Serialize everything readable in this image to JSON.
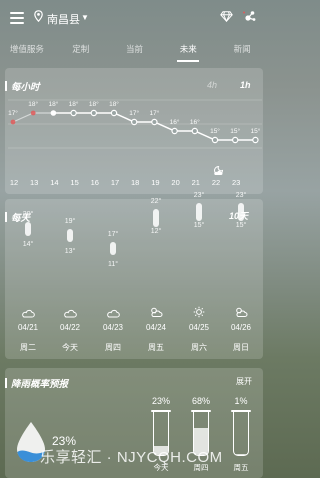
{
  "header": {
    "location": "南昌县",
    "colors": {
      "accent_red": "#e05a5a",
      "drop_blue": "#3a8fd8"
    }
  },
  "tabs": [
    {
      "label": "增值服务",
      "active": false
    },
    {
      "label": "定制",
      "active": false
    },
    {
      "label": "当前",
      "active": false
    },
    {
      "label": "未来",
      "active": true
    },
    {
      "label": "新闻",
      "active": false
    }
  ],
  "hourly": {
    "title": "每小时",
    "toggle_off": "4h",
    "toggle_on": "1h",
    "hours": [
      "12",
      "13",
      "14",
      "15",
      "16",
      "17",
      "18",
      "19",
      "20",
      "21",
      "22",
      "23"
    ],
    "temps": [
      "17°",
      "18°",
      "18°",
      "18°",
      "18°",
      "18°",
      "17°",
      "17°",
      "16°",
      "16°",
      "15°",
      "15°",
      "15°"
    ],
    "temp_values": [
      17,
      18,
      18,
      18,
      18,
      18,
      17,
      17,
      16,
      16,
      15,
      15,
      15
    ],
    "current_index": 2
  },
  "daily": {
    "title": "每天",
    "range_label": "10天",
    "days": [
      {
        "high": "20°",
        "low": "14°",
        "date": "04/21",
        "week": "周二",
        "icon": "cloudy-icon"
      },
      {
        "high": "19°",
        "low": "13°",
        "date": "04/22",
        "week": "今天",
        "icon": "cloudy-icon"
      },
      {
        "high": "17°",
        "low": "11°",
        "date": "04/23",
        "week": "周四",
        "icon": "cloudy-icon"
      },
      {
        "high": "22°",
        "low": "12°",
        "date": "04/24",
        "week": "周五",
        "icon": "partly-cloudy-icon"
      },
      {
        "high": "23°",
        "low": "15°",
        "date": "04/25",
        "week": "周六",
        "icon": "sunny-icon"
      },
      {
        "high": "23°",
        "low": "15°",
        "date": "04/26",
        "week": "周日",
        "icon": "partly-cloudy-icon"
      }
    ]
  },
  "rain": {
    "title": "降雨概率预报",
    "expand_label": "展开",
    "current_pct": "23%",
    "cups": [
      {
        "pct": "23%",
        "label": "今天",
        "value": 0.23
      },
      {
        "pct": "68%",
        "label": "周四",
        "value": 0.68
      },
      {
        "pct": "1%",
        "label": "周五",
        "value": 0.01
      }
    ]
  },
  "watermark": "乐享轻汇 · NJYCQH.COM"
}
